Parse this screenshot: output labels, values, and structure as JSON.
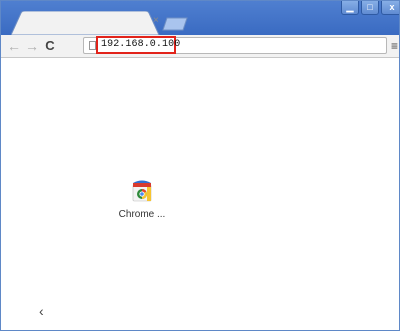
{
  "tab": {
    "close_glyph": "×"
  },
  "window_controls": {
    "minimize": "▁",
    "maximize": "□",
    "close": "x"
  },
  "toolbar": {
    "back_icon": "←",
    "forward_icon": "→",
    "reload_icon": "C",
    "menu_icon": "≡"
  },
  "omnibox": {
    "url": "192.168.0.100",
    "highlight_color": "#e2231a"
  },
  "apps": [
    {
      "label": "Chrome ...",
      "icon": "chrome-web-store-icon"
    }
  ],
  "pager": {
    "prev_icon": "‹"
  },
  "colors": {
    "titlebar": "#3a6bc2",
    "toolbar": "#f2f2f2",
    "highlight": "#e2231a"
  }
}
